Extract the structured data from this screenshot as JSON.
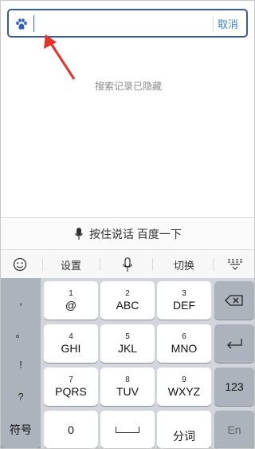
{
  "search": {
    "placeholder": "",
    "value": "",
    "cancel_label": "取消"
  },
  "history_hidden_text": "搜索记录已隐藏",
  "voice": {
    "label": "按住说话 百度一下",
    "icon": "microphone-icon"
  },
  "toolbar": {
    "emoji_icon": "emoji-face-icon",
    "settings_label": "设置",
    "mic_icon": "microphone-icon",
    "switch_label": "切换",
    "hide_keyboard_icon": "keyboard-hide-icon"
  },
  "keyboard": {
    "punctuation": [
      ",",
      "。",
      "!",
      "?"
    ],
    "rows": [
      [
        {
          "num": "1",
          "letters": "@"
        },
        {
          "num": "2",
          "letters": "ABC"
        },
        {
          "num": "3",
          "letters": "DEF"
        }
      ],
      [
        {
          "num": "4",
          "letters": "GHI"
        },
        {
          "num": "5",
          "letters": "JKL"
        },
        {
          "num": "6",
          "letters": "MNO"
        }
      ],
      [
        {
          "num": "7",
          "letters": "PQRS"
        },
        {
          "num": "8",
          "letters": "TUV"
        },
        {
          "num": "9",
          "letters": "WXYZ"
        }
      ]
    ],
    "delete_icon": "backspace-icon",
    "enter_icon": "return-icon",
    "numbers_label": "123",
    "symbols_label": "符号",
    "zero_label": "0",
    "space_icon": "space-icon",
    "segment_label": "分词",
    "lang_label": "En"
  },
  "colors": {
    "search_border": "#3a57a3",
    "accent": "#3b82d9",
    "arrow": "#e8312a"
  }
}
